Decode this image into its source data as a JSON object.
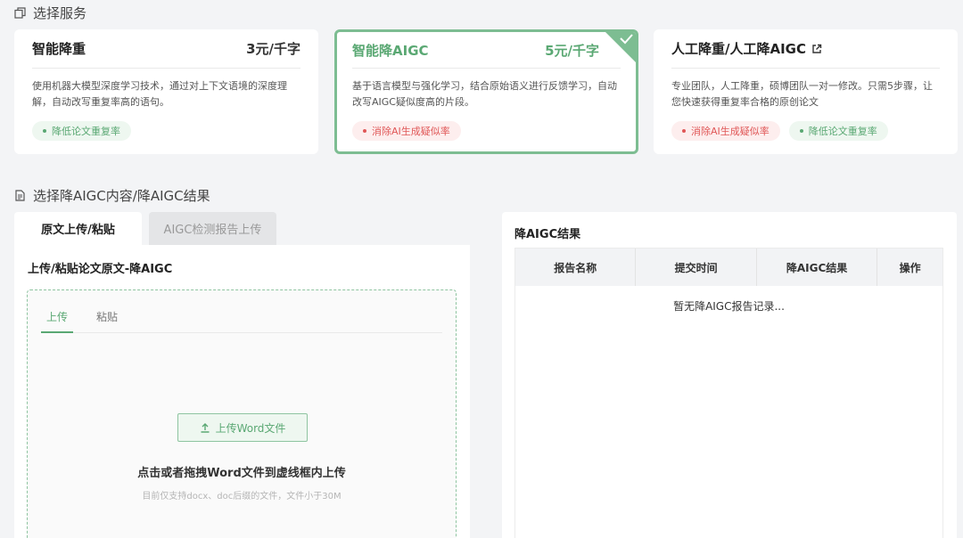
{
  "sections": {
    "service": "选择服务",
    "content": "选择降AIGC内容/降AIGC结果"
  },
  "cards": [
    {
      "title": "智能降重",
      "price": "3元/千字",
      "desc": "使用机器大模型深度学习技术，通过对上下文语境的深度理解，自动改写重复率高的语句。",
      "tags": [
        {
          "label": "降低论文重复率",
          "color": "green"
        }
      ]
    },
    {
      "title": "智能降AIGC",
      "price": "5元/千字",
      "desc": "基于语言模型与强化学习，结合原始语义进行反馈学习，自动改写AIGC疑似度高的片段。",
      "tags": [
        {
          "label": "消除AI生成疑似率",
          "color": "red"
        }
      ],
      "selected": true
    },
    {
      "title": "人工降重/人工降AIGC",
      "price": "",
      "desc": "专业团队，人工降重，硕博团队一对一修改。只需5步骤，让您快速获得重复率合格的原创论文",
      "tags": [
        {
          "label": "消除AI生成疑似率",
          "color": "red"
        },
        {
          "label": "降低论文重复率",
          "color": "green"
        }
      ],
      "icon": "external-link-icon"
    }
  ],
  "tabs": [
    "原文上传/粘贴",
    "AIGC检测报告上传"
  ],
  "left_panel": {
    "title": "上传/粘贴论文原文-降AIGC",
    "sub_tabs": [
      "上传",
      "粘贴"
    ],
    "upload_button": "上传Word文件",
    "hint": "点击或者拖拽Word文件到虚线框内上传",
    "sub_hint": "目前仅支持docx、doc后缀的文件，文件小于30M"
  },
  "right_panel": {
    "title": "降AIGC结果",
    "columns": [
      "报告名称",
      "提交时间",
      "降AIGC结果",
      "操作"
    ],
    "empty": "暂无降AIGC报告记录..."
  },
  "colors": {
    "accent": "#5aa873",
    "accent_border": "#7dbd92",
    "red": "#e05757"
  }
}
